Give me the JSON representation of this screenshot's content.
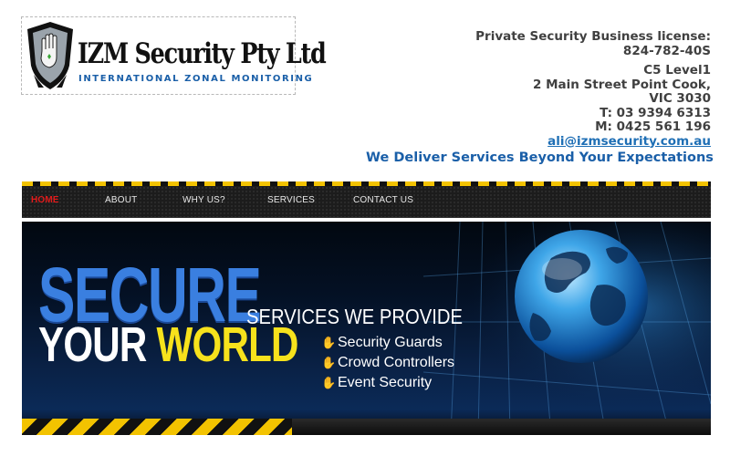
{
  "logo": {
    "title": "IZM Security Pty Ltd",
    "subtitle": "INTERNATIONAL ZONAL MONITORING",
    "icon": "shield-hand-icon"
  },
  "contact": {
    "license_label": "Private Security Business license:",
    "license_number": "824-782-40S",
    "address_line1": "C5 Level1",
    "address_line2": "2 Main Street Point Cook,",
    "address_line3": "VIC 3030",
    "phone": "T: 03 9394 6313",
    "mobile": "M: 0425 561 196",
    "email": "ali@izmsecurity.com.au"
  },
  "tagline": "We Deliver Services Beyond Your Expectations",
  "nav": {
    "items": [
      {
        "label": "HOME",
        "active": true
      },
      {
        "label": "ABOUT",
        "active": false
      },
      {
        "label": "WHY US?",
        "active": false
      },
      {
        "label": "SERVICES",
        "active": false
      },
      {
        "label": "CONTACT US",
        "active": false
      }
    ]
  },
  "banner": {
    "headline_1": "SECURE",
    "headline_2a": "YOUR",
    "headline_2b": "WORLD",
    "services_title": "SERVICES WE PROVIDE",
    "services": [
      "Security Guards",
      "Crowd Controllers",
      "Event Security"
    ],
    "bullet_icon": "hand-icon",
    "image": "globe-icon"
  },
  "colors": {
    "brand_blue": "#1a5fa8",
    "nav_active": "#e11b1b",
    "stripe_yellow": "#f3c300",
    "bullet_green": "#4fcf35"
  }
}
